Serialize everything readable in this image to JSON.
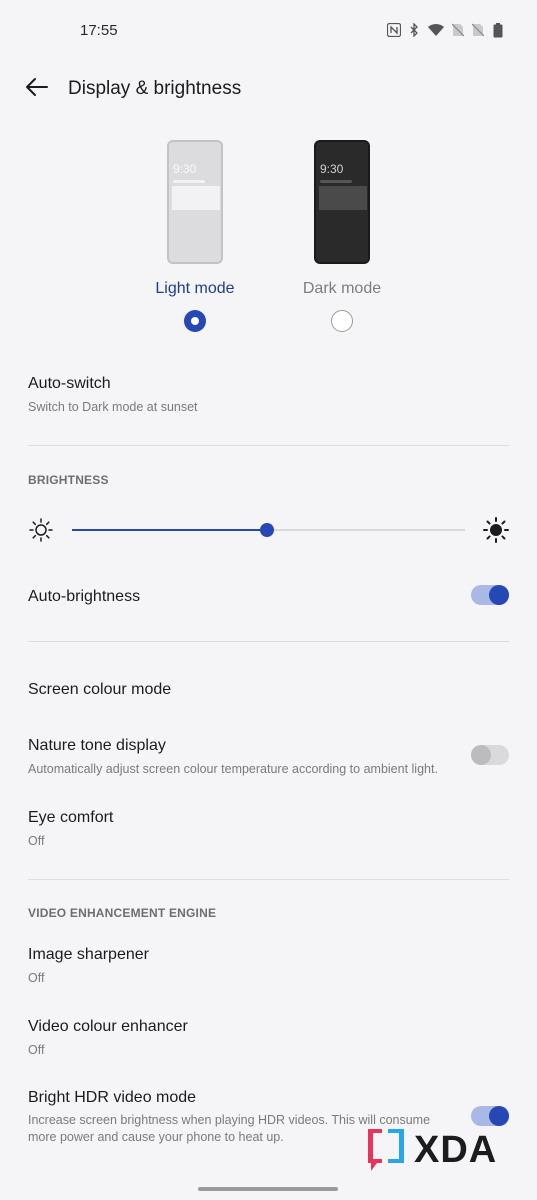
{
  "status_bar": {
    "time": "17:55",
    "icons": [
      "nfc-icon",
      "bluetooth-icon",
      "wifi-icon",
      "no-sim-icon",
      "no-sim-icon",
      "battery-icon"
    ]
  },
  "header": {
    "back_icon": "arrow-back-icon",
    "title": "Display & brightness"
  },
  "theme_modes": [
    {
      "label": "Light mode",
      "preview_time": "9:30",
      "selected": true
    },
    {
      "label": "Dark mode",
      "preview_time": "9:30",
      "selected": false
    }
  ],
  "auto_switch": {
    "title": "Auto-switch",
    "subtitle": "Switch to Dark mode at sunset"
  },
  "brightness": {
    "section_label": "BRIGHTNESS",
    "level": 0.495,
    "min_icon": "sun-outline-icon",
    "max_icon": "sun-filled-icon"
  },
  "auto_brightness": {
    "title": "Auto-brightness",
    "enabled": true
  },
  "screen_colour_mode": {
    "title": "Screen colour mode"
  },
  "nature_tone": {
    "title": "Nature tone display",
    "subtitle": "Automatically adjust screen colour temperature according to ambient light.",
    "enabled": false
  },
  "eye_comfort": {
    "title": "Eye comfort",
    "subtitle": "Off"
  },
  "video_section": {
    "section_label": "VIDEO ENHANCEMENT ENGINE"
  },
  "image_sharpener": {
    "title": "Image sharpener",
    "subtitle": "Off"
  },
  "video_colour": {
    "title": "Video colour enhancer",
    "subtitle": "Off"
  },
  "bright_hdr": {
    "title": "Bright HDR video mode",
    "subtitle": "Increase screen brightness when playing HDR videos. This will consume more power and cause your phone to heat up.",
    "enabled": true
  },
  "watermark": {
    "text": "XDA"
  },
  "colors": {
    "accent": "#2548b5",
    "background": "#f5f5f7"
  }
}
